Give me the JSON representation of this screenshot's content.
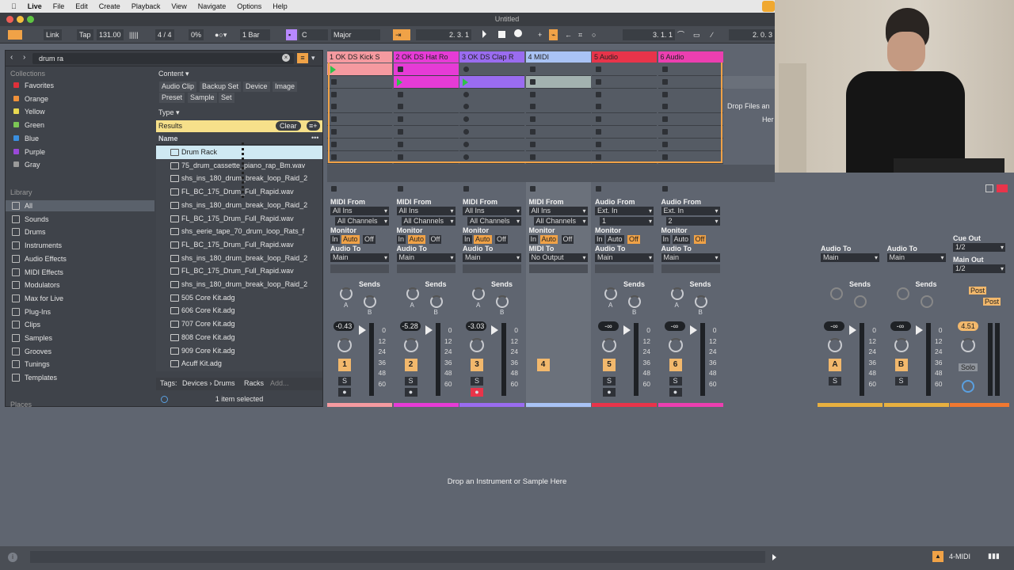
{
  "menubar": {
    "app": "Live",
    "items": [
      "File",
      "Edit",
      "Create",
      "Playback",
      "View",
      "Navigate",
      "Options",
      "Help"
    ]
  },
  "window_title": "Untitled",
  "control": {
    "link": "Link",
    "tap": "Tap",
    "tempo": "131.00",
    "time_sig": "4 / 4",
    "cpu": "0%",
    "quantize": "1 Bar",
    "key": "C",
    "scale": "Major",
    "position": "2.   3.   1",
    "loop_start": "3.   1.   1",
    "loop_len": "2.   0.   3"
  },
  "browser": {
    "search": "drum ra",
    "collections_header": "Collections",
    "collections": [
      {
        "label": "Favorites",
        "color": "#e0303a"
      },
      {
        "label": "Orange",
        "color": "#f0913a"
      },
      {
        "label": "Yellow",
        "color": "#e8d850"
      },
      {
        "label": "Green",
        "color": "#7cc655"
      },
      {
        "label": "Blue",
        "color": "#3a8fe0"
      },
      {
        "label": "Purple",
        "color": "#9a48d8"
      },
      {
        "label": "Gray",
        "color": "#9a9a9a"
      }
    ],
    "library_header": "Library",
    "library": [
      "All",
      "Sounds",
      "Drums",
      "Instruments",
      "Audio Effects",
      "MIDI Effects",
      "Modulators",
      "Max for Live",
      "Plug-Ins",
      "Clips",
      "Samples",
      "Grooves",
      "Tunings",
      "Templates"
    ],
    "places_header": "Places",
    "content_label": "Content ▾",
    "content_tags": [
      "Audio Clip",
      "Backup Set",
      "Device",
      "Image",
      "Preset",
      "Sample",
      "Set"
    ],
    "type_label": "Type ▾",
    "results_label": "Results",
    "clear_label": "Clear",
    "name_col": "Name",
    "results": [
      "Drum Rack",
      "75_drum_cassette_piano_rap_Bm.wav",
      "shs_ins_180_drum_break_loop_Raid_2",
      "FL_BC_175_Drum_Full_Rapid.wav",
      "shs_ins_180_drum_break_loop_Raid_2",
      "FL_BC_175_Drum_Full_Rapid.wav",
      "shs_eerie_tape_70_drum_loop_Rats_f",
      "FL_BC_175_Drum_Full_Rapid.wav",
      "shs_ins_180_drum_break_loop_Raid_2",
      "FL_BC_175_Drum_Full_Rapid.wav",
      "shs_ins_180_drum_break_loop_Raid_2",
      "505 Core Kit.adg",
      "606 Core Kit.adg",
      "707 Core Kit.adg",
      "808 Core Kit.adg",
      "909 Core Kit.adg",
      "Acuff Kit.adg"
    ],
    "tags_label": "Tags:",
    "tags_path": "Devices › Drums",
    "tags_racks": "Racks",
    "tags_add": "Add...",
    "status": "1 item selected"
  },
  "tracks": [
    {
      "name": "1 OK DS Kick S",
      "color": "#f59aa0",
      "num": "1",
      "vol": "-0.43",
      "type": "midi",
      "in": "All Ins",
      "ch": "All Channels",
      "mon": "Auto",
      "out": "Main"
    },
    {
      "name": "2 OK DS Hat Ro",
      "color": "#e63bd6",
      "num": "2",
      "vol": "-5.28",
      "type": "midi",
      "in": "All Ins",
      "ch": "All Channels",
      "mon": "Auto",
      "out": "Main"
    },
    {
      "name": "3 OK DS Clap R",
      "color": "#9a6cf0",
      "num": "3",
      "vol": "-3.03",
      "type": "midi",
      "in": "All Ins",
      "ch": "All Channels",
      "mon": "Auto",
      "out": "Main"
    },
    {
      "name": "4 MIDI",
      "color": "#a9c3f5",
      "num": "4",
      "vol": "",
      "type": "midi",
      "in": "All Ins",
      "ch": "All Channels",
      "mon": "Auto",
      "out": "No Output"
    },
    {
      "name": "5 Audio",
      "color": "#e8344a",
      "num": "5",
      "vol": "-∞",
      "type": "audio",
      "in": "Ext. In",
      "ch": "1",
      "mon": "Off",
      "out": "Main"
    },
    {
      "name": "6 Audio",
      "color": "#ec3fb0",
      "num": "6",
      "vol": "-∞",
      "type": "audio",
      "in": "Ext. In",
      "ch": "2",
      "mon": "Off",
      "out": "Main"
    }
  ],
  "labels": {
    "midi_from": "MIDI From",
    "audio_from": "Audio From",
    "monitor": "Monitor",
    "midi_to": "MIDI To",
    "audio_to": "Audio To",
    "sends": "Sends",
    "in": "In",
    "auto": "Auto",
    "off": "Off",
    "s": "S",
    "a": "A",
    "b": "B",
    "cue_out": "Cue Out",
    "main_out": "Main Out",
    "solo": "Solo",
    "post": "Post",
    "drop_files": "Drop Files an",
    "drop_here": "Her",
    "drop_instrument": "Drop an Instrument or Sample Here",
    "bottom_track": "4-MIDI"
  },
  "returns": [
    {
      "letter": "A",
      "out": "Main",
      "vol": "-∞",
      "color": "#e8b040"
    },
    {
      "letter": "B",
      "out": "Main",
      "vol": "-∞",
      "color": "#e8b040"
    }
  ],
  "master": {
    "vol": "4.51",
    "cue": "1/2",
    "main": "1/2",
    "color": "#f07830"
  },
  "db_scale": [
    "0",
    "12",
    "24",
    "36",
    "48",
    "60"
  ]
}
